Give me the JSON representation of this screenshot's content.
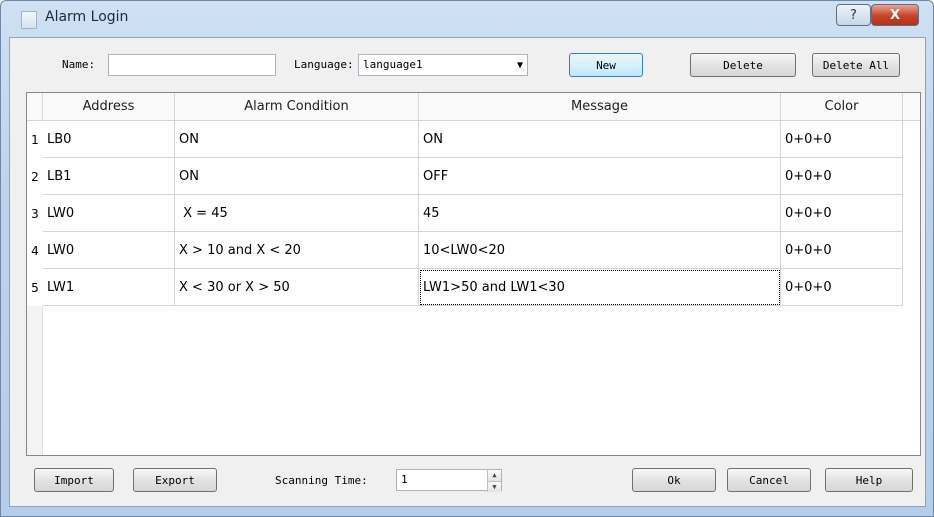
{
  "window": {
    "title": "Alarm Login",
    "help_label": "?",
    "close_label": "X"
  },
  "form": {
    "name_label": "Name:",
    "name_value": "",
    "language_label": "Language:",
    "language_value": "language1",
    "new_label": "New",
    "delete_label": "Delete",
    "delete_all_label": "Delete All"
  },
  "table": {
    "columns": [
      "Address",
      "Alarm Condition",
      "Message",
      "Color"
    ],
    "rows": [
      {
        "num": "1",
        "address": "LB0",
        "condition": "ON",
        "message": "ON",
        "color": "0+0+0"
      },
      {
        "num": "2",
        "address": "LB1",
        "condition": "ON",
        "message": "OFF",
        "color": "0+0+0"
      },
      {
        "num": "3",
        "address": "LW0",
        "condition": " X = 45",
        "message": "45",
        "color": "0+0+0"
      },
      {
        "num": "4",
        "address": "LW0",
        "condition": "X > 10 and X < 20",
        "message": "10<LW0<20",
        "color": "0+0+0"
      },
      {
        "num": "5",
        "address": "LW1",
        "condition": "X < 30 or X > 50",
        "message": "LW1>50 and LW1<30",
        "color": "0+0+0"
      }
    ]
  },
  "footer": {
    "import_label": "Import",
    "export_label": "Export",
    "scanning_label": "Scanning Time:",
    "scanning_value": "1",
    "ok_label": "Ok",
    "cancel_label": "Cancel",
    "help_label": "Help"
  },
  "icons": {
    "combo_arrow": "chevron-down-icon",
    "spin_up": "spin-up-icon",
    "spin_down": "spin-down-icon"
  }
}
